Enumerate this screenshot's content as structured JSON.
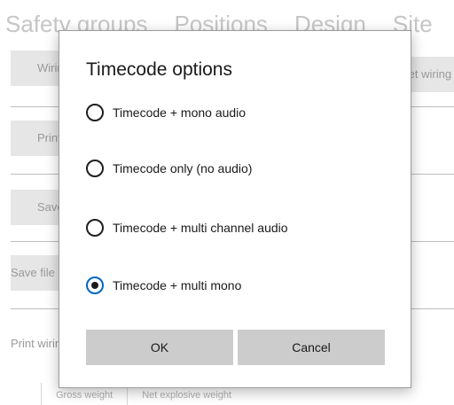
{
  "background": {
    "tabs": [
      "Safety groups",
      "Positions",
      "Design",
      "Site"
    ],
    "buttons": [
      "Wiring",
      "Print",
      "Save",
      "Save file",
      "Print wiring"
    ],
    "right_button": "Set wiring",
    "column_headers": [
      "Gross weight",
      "Net explosive weight"
    ]
  },
  "dialog": {
    "title": "Timecode options",
    "options": [
      {
        "label": "Timecode + mono audio",
        "checked": false
      },
      {
        "label": "Timecode only (no audio)",
        "checked": false
      },
      {
        "label": "Timecode + multi channel audio",
        "checked": false
      },
      {
        "label": "Timecode + multi mono",
        "checked": true
      }
    ],
    "ok_label": "OK",
    "cancel_label": "Cancel"
  },
  "colors": {
    "accent": "#0067c0",
    "button_bg": "#cccccc",
    "disabled_text": "#c6c6c6"
  }
}
